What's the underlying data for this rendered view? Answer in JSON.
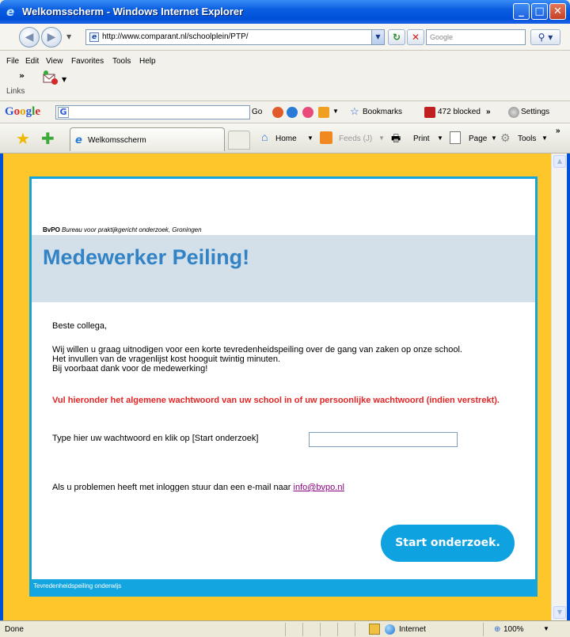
{
  "window": {
    "title": "Welkomsscherm - Windows Internet Explorer",
    "minimize": "_",
    "maximize": "□",
    "close": "✕"
  },
  "address_bar": {
    "url": "http://www.comparant.nl/schoolplein/PTP/",
    "search_placeholder": "Google"
  },
  "menu": {
    "items": [
      "File",
      "Edit",
      "View",
      "Favorites",
      "Tools",
      "Help"
    ],
    "links_label": "Links"
  },
  "google_toolbar": {
    "logo": "Google",
    "go_label": "Go",
    "bookmarks_label": "Bookmarks",
    "blocked_label": "472 blocked",
    "settings_label": "Settings"
  },
  "tabs": {
    "active_tab_label": "Welkomsscherm"
  },
  "command_bar": {
    "home": "Home",
    "feeds": "Feeds (J)",
    "print": "Print",
    "page": "Page",
    "tools": "Tools"
  },
  "page": {
    "org_abbr": "BvPO",
    "org_name": "Bureau voor praktijkgericht onderzoek, Groningen",
    "heading": "Medewerker Peiling!",
    "greeting": "Beste collega,",
    "intro_lines": [
      "Wij willen u graag uitnodigen voor een korte tevredenheidspeiling over de gang van zaken op onze school.",
      "Het invullen van de vragenlijst kost hooguit twintig minuten.",
      "Bij voorbaat dank voor de medewerking!"
    ],
    "warning": "Vul hieronder het algemene wachtwoord van uw school in of uw persoonlijke wachtwoord (indien verstrekt).",
    "password_label": "Type hier uw wachtwoord en klik op [Start onderzoek]",
    "password_value": "",
    "help_text": "Als u problemen heeft met inloggen stuur dan een e-mail naar ",
    "help_email": "info@bvpo.nl",
    "start_button": "Start onderzoek.",
    "footer": "Tevredenheidspeiling onderwijs"
  },
  "status_bar": {
    "status": "Done",
    "zone": "Internet",
    "zoom": "100%"
  },
  "colors": {
    "page_background": "#fdc72c",
    "accent_blue": "#13a5e0",
    "heading_blue": "#3183c5",
    "warning_red": "#e32525",
    "banner_bg": "#d3dfe9"
  }
}
